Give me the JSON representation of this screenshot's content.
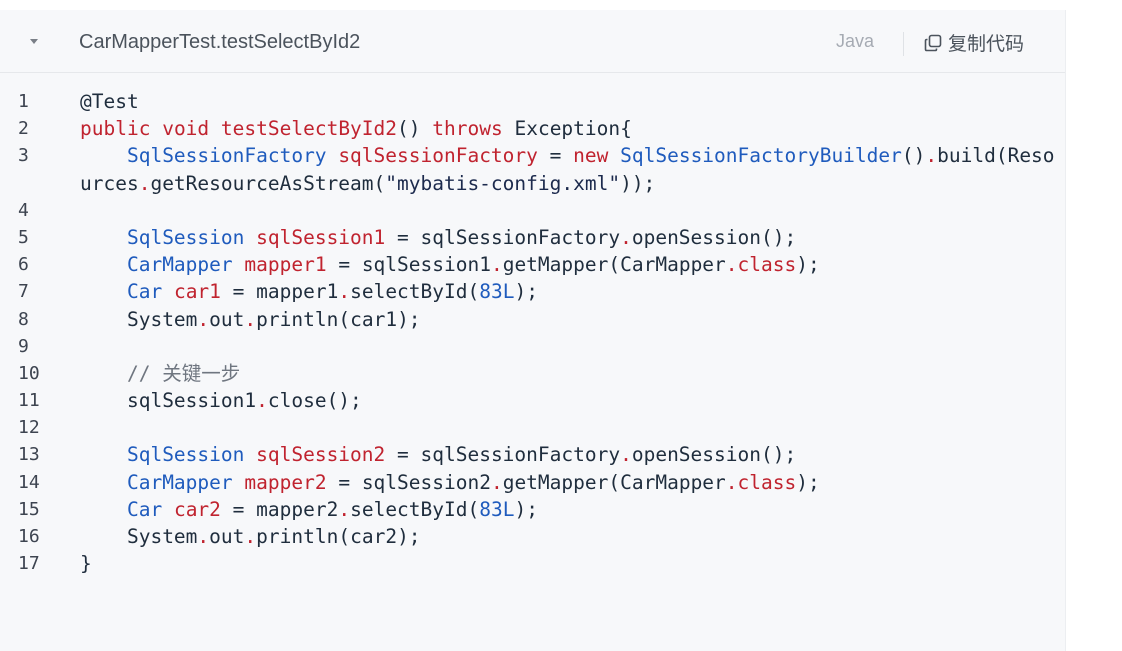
{
  "header": {
    "filename": "CarMapperTest.testSelectById2",
    "language": "Java",
    "copy_label": "复制代码"
  },
  "code": {
    "line_numbers": [
      "1",
      "2",
      "3",
      "4",
      "5",
      "6",
      "7",
      "8",
      "9",
      "10",
      "11",
      "12",
      "13",
      "14",
      "15",
      "16",
      "17"
    ],
    "lines": [
      "@Test",
      "public void testSelectById2() throws Exception{",
      "    SqlSessionFactory sqlSessionFactory = new SqlSessionFactoryBuilder().build(Resources.getResourceAsStream(\"mybatis-config.xml\"));",
      "",
      "    SqlSession sqlSession1 = sqlSessionFactory.openSession();",
      "    CarMapper mapper1 = sqlSession1.getMapper(CarMapper.class);",
      "    Car car1 = mapper1.selectById(83L);",
      "    System.out.println(car1);",
      "",
      "    // 关键一步",
      "    sqlSession1.close();",
      "",
      "    SqlSession sqlSession2 = sqlSessionFactory.openSession();",
      "    CarMapper mapper2 = sqlSession2.getMapper(CarMapper.class);",
      "    Car car2 = mapper2.selectById(83L);",
      "    System.out.println(car2);",
      "}"
    ]
  },
  "colors": {
    "background": "#f7f8fa",
    "keyword": "#c0232f",
    "type": "#1f5bbd",
    "text": "#1f2d3d",
    "comment": "#6f7680"
  },
  "icons": [
    "chevron-down-icon",
    "copy-icon"
  ]
}
